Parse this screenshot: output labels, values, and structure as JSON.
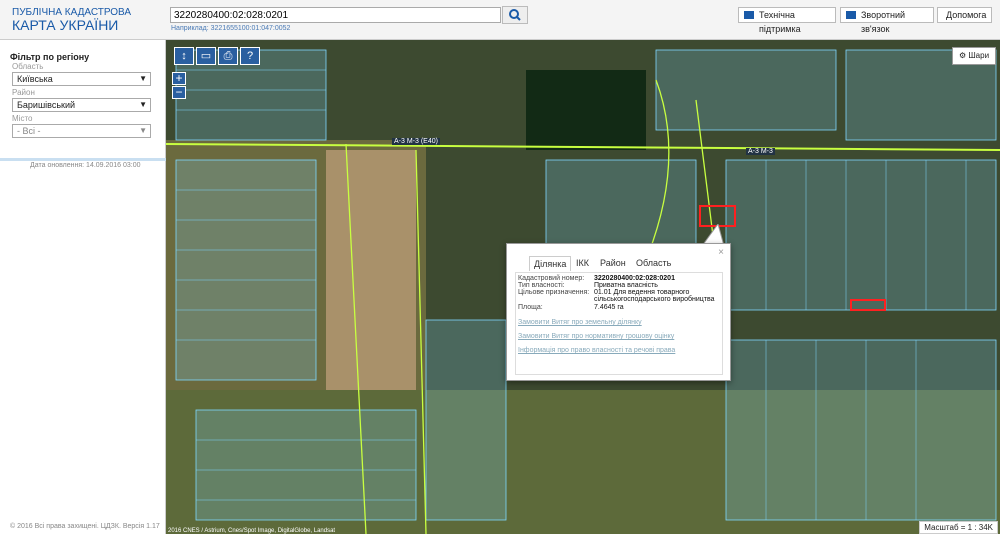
{
  "logo": {
    "line1": "ПУБЛІЧНА КАДАСТРОВА",
    "line2": "КАРТА УКРАЇНИ"
  },
  "search": {
    "value": "3220280400:02:028:0201",
    "example": "Наприклад: 3221655100:01:047:0052"
  },
  "header_buttons": {
    "support": "Технічна підтримка",
    "feedback": "Зворотний зв'язок",
    "help": "Допомога"
  },
  "sidebar": {
    "title": "Фільтр по регіону",
    "region_label": "Область",
    "region_value": "Київська",
    "district_label": "Район",
    "district_value": "Баришівський",
    "city_label": "Місто",
    "city_value": "- Всі -",
    "updated": "Дата оновлення: 14.09.2016 03:00",
    "copyright": "© 2016 Всі права захищені. ЦДЗК. Версія 1.17"
  },
  "map": {
    "layers_label": "Шари",
    "zoom_in": "+",
    "zoom_out": "−",
    "road1": "А-3 М-3 (Е40)",
    "road2": "А-3 М-3",
    "scale": "Масштаб = 1 : 34K",
    "attribution": "2016 CNES / Astrium, Cnes/Spot Image, DigitalGlobe, Landsat"
  },
  "popup": {
    "tabs": [
      "Ділянка",
      "ІКК",
      "Район",
      "Область"
    ],
    "fields": [
      {
        "k": "Кадастровий номер:",
        "v": "3220280400:02:028:0201"
      },
      {
        "k": "Тип власності:",
        "v": "Приватна власність"
      },
      {
        "k": "Цільове призначення:",
        "v": "01.01 Для ведення товарного сільськогосподарського виробництва"
      },
      {
        "k": "Площа:",
        "v": "7.4645 га"
      }
    ],
    "links": [
      "Замовити Витяг про земельну ділянку",
      "Замовити Витяг про нормативну грошову оцінку",
      "Інформація про право власності та речові права"
    ],
    "close": "×"
  },
  "colors": {
    "accent": "#1a5aa8",
    "parcel": "#7fd7ff",
    "highlight": "#ff2020",
    "boundary": "#c8ff40"
  }
}
